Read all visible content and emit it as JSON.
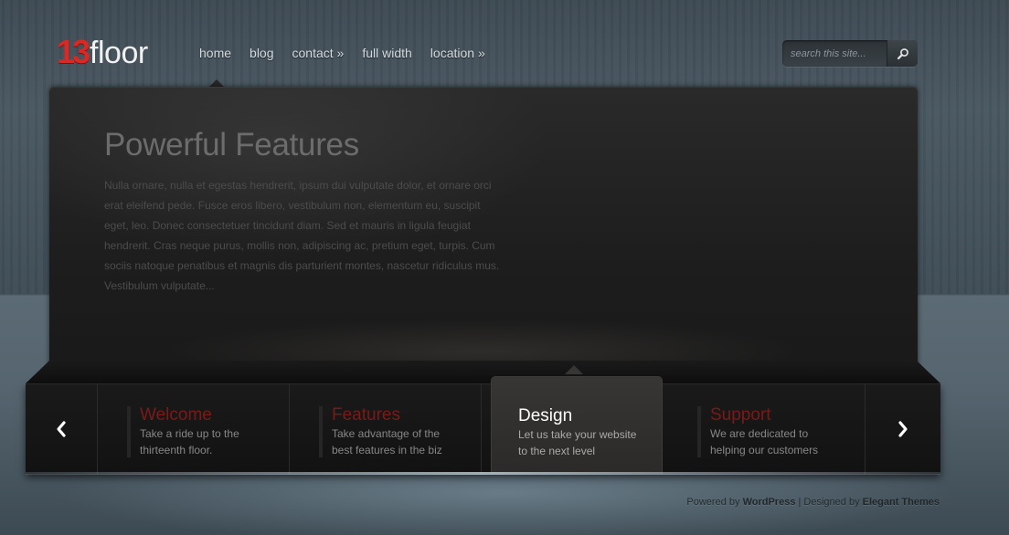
{
  "logo": {
    "number": "13",
    "word": "floor"
  },
  "nav": {
    "items": [
      {
        "label": "home"
      },
      {
        "label": "blog"
      },
      {
        "label": "contact »"
      },
      {
        "label": "full width"
      },
      {
        "label": "location »"
      }
    ]
  },
  "search": {
    "placeholder": "search this site...",
    "icon": "magnifier-icon"
  },
  "feature": {
    "title": "Powerful Features",
    "text": "Nulla ornare, nulla et egestas hendrerit, ipsum dui vulputate dolor, et ornare orci erat eleifend pede. Fusce eros libero, vestibulum non, elementum eu, suscipit eget, leo. Donec consectetuer tincidunt diam. Sed et mauris in ligula feugiat hendrerit. Cras neque purus, mollis non, adipiscing ac, pretium eget, turpis. Cum sociis natoque penatibus et magnis dis parturient montes, nascetur ridiculus mus. Vestibulum vulputate..."
  },
  "slider": {
    "prev_icon": "chevron-left-icon",
    "next_icon": "chevron-right-icon",
    "tabs": [
      {
        "title": "Welcome",
        "line1": "Take a ride up to the",
        "line2": "thirteenth floor."
      },
      {
        "title": "Features",
        "line1": "Take advantage of the",
        "line2": "best features in the biz"
      },
      {
        "title": "Design",
        "line1": "Let us take your website",
        "line2": "to the next level"
      },
      {
        "title": "Support",
        "line1": "We are dedicated to",
        "line2": "helping our customers"
      }
    ]
  },
  "footer": {
    "powered_prefix": "Powered by",
    "powered_link": "WordPress",
    "separator": " | ",
    "designed_prefix": "Designed by",
    "designed_link": "Elegant Themes"
  },
  "colors": {
    "accent": "#d52a26",
    "tab_title": "#7a1a18",
    "active_title": "#ffffff"
  }
}
